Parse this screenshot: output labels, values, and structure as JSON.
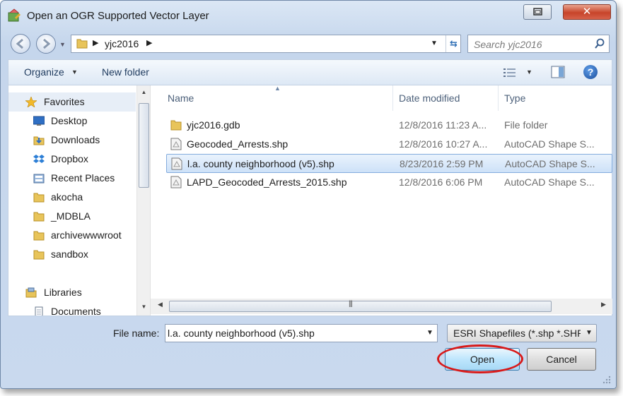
{
  "window": {
    "title": "Open an OGR Supported Vector Layer"
  },
  "navbar": {
    "path": [
      "yjc2016"
    ],
    "search_placeholder": "Search yjc2016"
  },
  "toolbar": {
    "organize_label": "Organize",
    "new_folder_label": "New folder"
  },
  "sidebar": {
    "favorites_label": "Favorites",
    "items": [
      {
        "label": "Desktop",
        "icon": "desktop-icon"
      },
      {
        "label": "Downloads",
        "icon": "downloads-icon"
      },
      {
        "label": "Dropbox",
        "icon": "dropbox-icon"
      },
      {
        "label": "Recent Places",
        "icon": "recent-places-icon"
      },
      {
        "label": "akocha",
        "icon": "folder-icon"
      },
      {
        "label": "_MDBLA",
        "icon": "folder-icon"
      },
      {
        "label": "archivewwwroot",
        "icon": "folder-icon"
      },
      {
        "label": "sandbox",
        "icon": "folder-icon"
      }
    ],
    "libraries_label": "Libraries",
    "library_items": [
      {
        "label": "Documents",
        "icon": "documents-icon"
      }
    ]
  },
  "file_list": {
    "columns": [
      "Name",
      "Date modified",
      "Type"
    ],
    "rows": [
      {
        "name": "yjc2016.gdb",
        "date": "12/8/2016 11:23 A...",
        "type": "File folder",
        "icon": "folder-icon",
        "selected": false
      },
      {
        "name": "Geocoded_Arrests.shp",
        "date": "12/8/2016 10:27 A...",
        "type": "AutoCAD Shape S...",
        "icon": "shapefile-icon",
        "selected": false
      },
      {
        "name": "l.a. county neighborhood (v5).shp",
        "date": "8/23/2016 2:59 PM",
        "type": "AutoCAD Shape S...",
        "icon": "shapefile-icon",
        "selected": true
      },
      {
        "name": "LAPD_Geocoded_Arrests_2015.shp",
        "date": "12/8/2016 6:06 PM",
        "type": "AutoCAD Shape S...",
        "icon": "shapefile-icon",
        "selected": false
      }
    ]
  },
  "footer": {
    "file_name_label": "File name:",
    "file_name_value": "l.a. county neighborhood (v5).shp",
    "filter_value": "ESRI Shapefiles (*.shp *.SHP)",
    "open_label": "Open",
    "cancel_label": "Cancel"
  },
  "colors": {
    "accent": "#3c7fb1",
    "highlight_ring": "#d81a1a",
    "selection": "#cde1f8"
  }
}
